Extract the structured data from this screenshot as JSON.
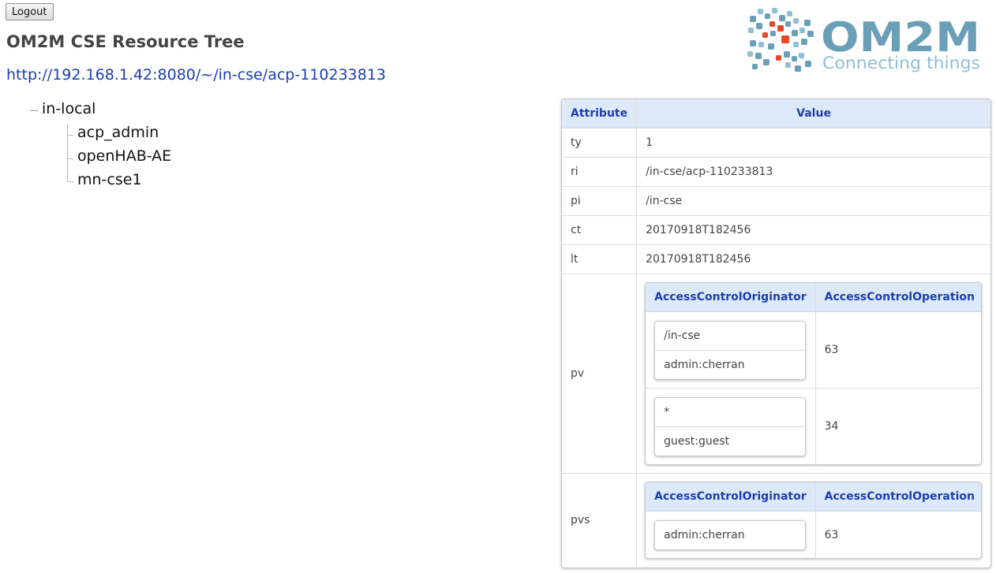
{
  "header": {
    "logout_label": "Logout",
    "title": "OM2M CSE Resource Tree",
    "url": "http://192.168.1.42:8080/~/in-cse/acp-110233813",
    "logo_text": "OM2M",
    "logo_tagline": "Connecting things"
  },
  "tree": {
    "root": "in-local",
    "children": [
      "acp_admin",
      "openHAB-AE",
      "mn-cse1"
    ]
  },
  "attributes": {
    "col_attribute": "Attribute",
    "col_value": "Value",
    "rows": [
      {
        "name": "ty",
        "value": "1"
      },
      {
        "name": "ri",
        "value": "/in-cse/acp-110233813"
      },
      {
        "name": "pi",
        "value": "/in-cse"
      },
      {
        "name": "ct",
        "value": "20170918T182456"
      },
      {
        "name": "lt",
        "value": "20170918T182456"
      }
    ],
    "pv": {
      "name": "pv",
      "col_originator": "AccessControlOriginator",
      "col_operation": "AccessControlOperation",
      "rules": [
        {
          "originators": [
            "/in-cse",
            "admin:cherran"
          ],
          "operation": "63"
        },
        {
          "originators": [
            "*",
            "guest:guest"
          ],
          "operation": "34"
        }
      ]
    },
    "pvs": {
      "name": "pvs",
      "col_originator": "AccessControlOriginator",
      "col_operation": "AccessControlOperation",
      "rules": [
        {
          "originators": [
            "admin:cherran"
          ],
          "operation": "63"
        }
      ]
    }
  },
  "colors": {
    "header_bg": "#dde9f8",
    "header_text": "#1a3fb0",
    "link": "#1a3fb0",
    "logo_blue": "#6a9fb8",
    "logo_red": "#e8472a"
  }
}
